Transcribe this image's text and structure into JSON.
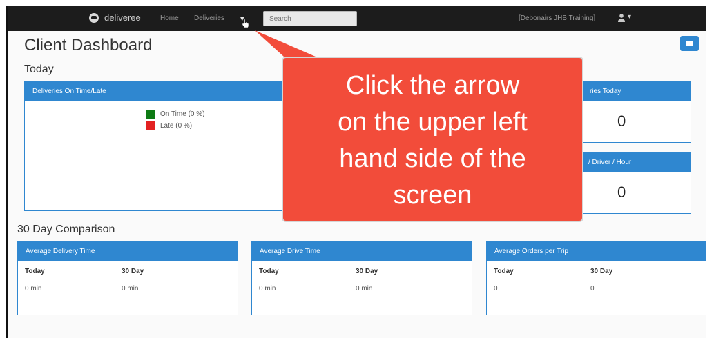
{
  "navbar": {
    "brand": "deliveree",
    "links": [
      "Home",
      "Deliveries"
    ],
    "dropdown_caret": "▾",
    "search_placeholder": "Search",
    "account": "[Debonairs JHB Training]",
    "user_caret": "▾"
  },
  "page": {
    "title": "Client Dashboard"
  },
  "today": {
    "title": "Today",
    "on_time_panel": {
      "title": "Deliveries On Time/Late",
      "legend": [
        {
          "label": "On Time (0 %)",
          "color": "#0e7a14"
        },
        {
          "label": "Late (0 %)",
          "color": "#e32222"
        }
      ]
    },
    "deliveries_today_panel": {
      "title": "ries Today",
      "value": "0"
    },
    "driver_hour_panel": {
      "title": "/ Driver / Hour",
      "value": "0"
    }
  },
  "comparison": {
    "title": "30 Day Comparison",
    "panels": [
      {
        "title": "Average Delivery Time",
        "headers": [
          "Today",
          "30 Day"
        ],
        "values": [
          "0 min",
          "0 min"
        ]
      },
      {
        "title": "Average Drive Time",
        "headers": [
          "Today",
          "30 Day"
        ],
        "values": [
          "0 min",
          "0 min"
        ]
      },
      {
        "title": "Average Orders per Trip",
        "headers": [
          "Today",
          "30 Day"
        ],
        "values": [
          "0",
          "0"
        ]
      }
    ]
  },
  "callout": {
    "lines": [
      "Click the arrow",
      "on the upper left",
      "hand side of the",
      "screen"
    ],
    "color": "#f24c3a"
  },
  "colors": {
    "navbar": "#1c1c1c",
    "panel_header": "#2f87d0"
  }
}
